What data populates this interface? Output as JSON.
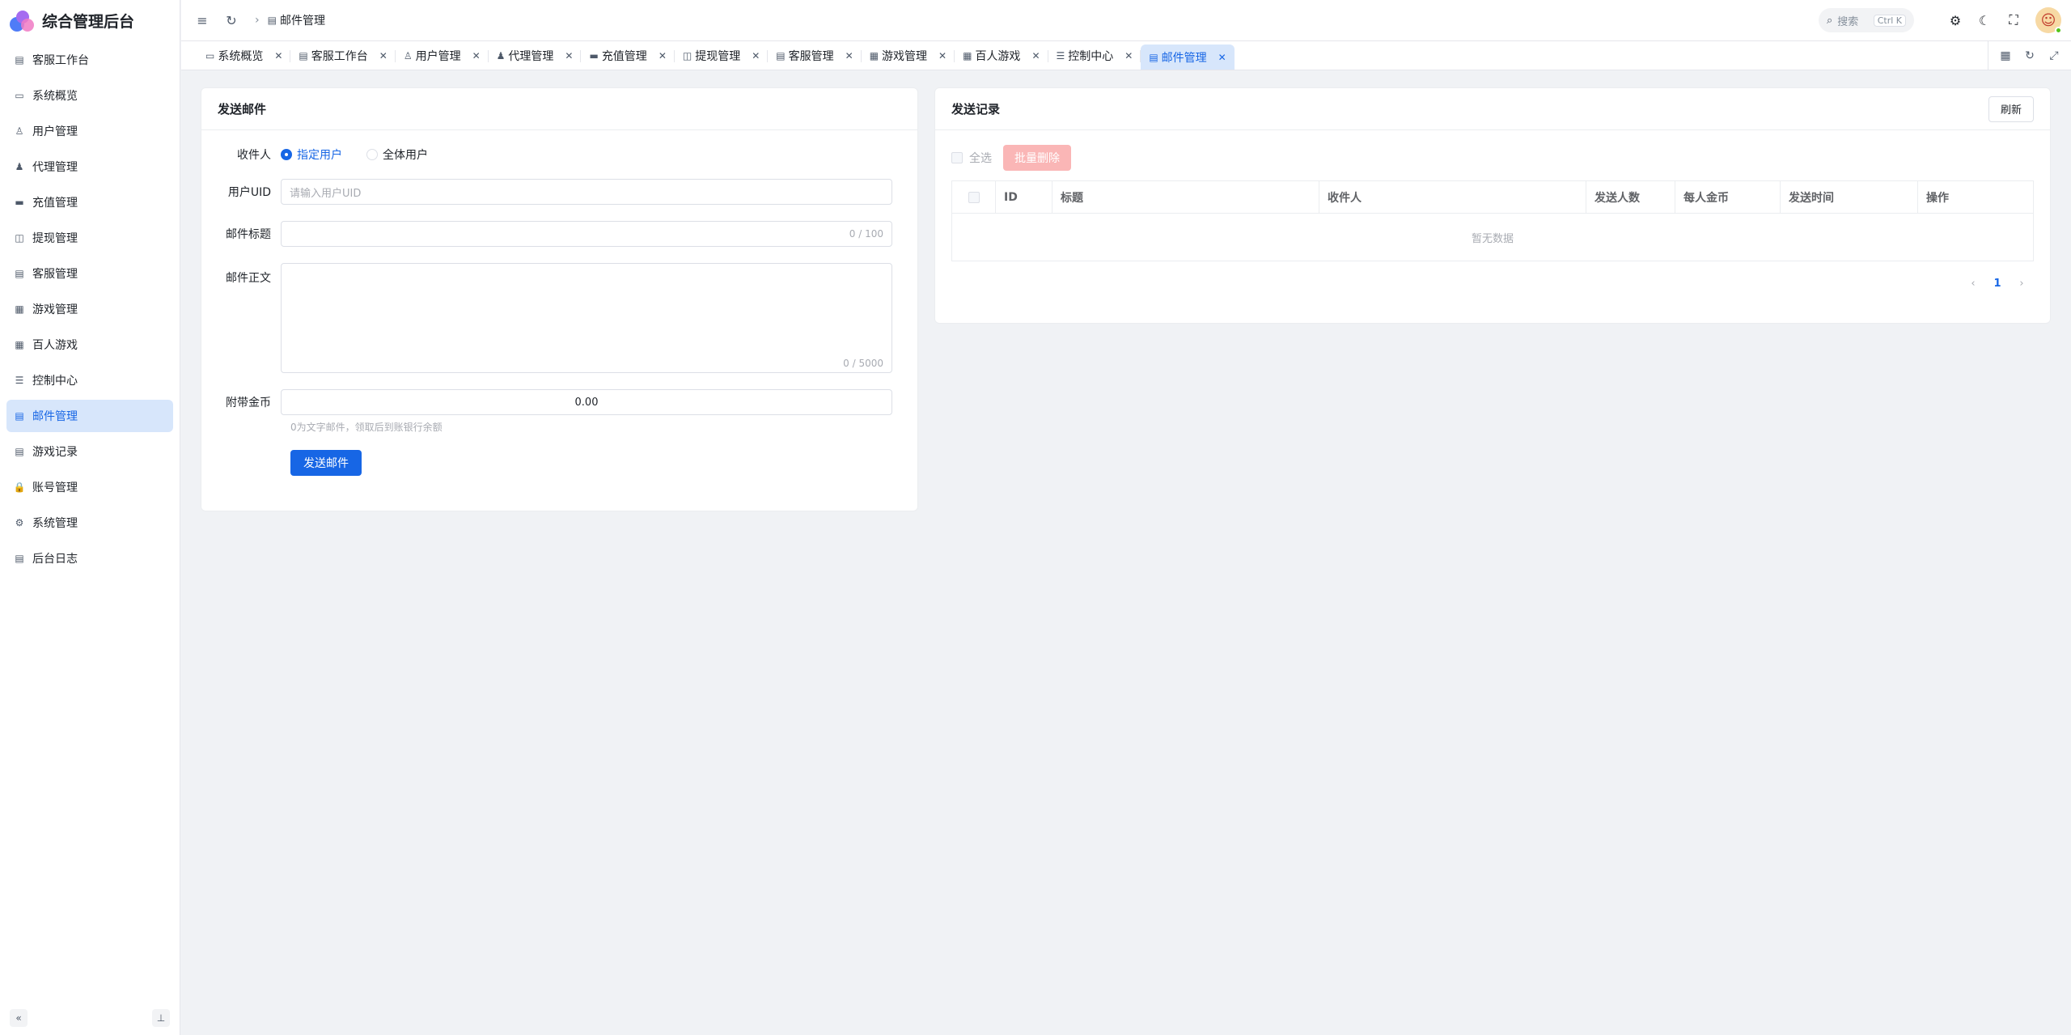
{
  "app": {
    "title": "综合管理后台"
  },
  "sidebar": {
    "items": [
      {
        "label": "客服工作台",
        "icon": "doc-icon"
      },
      {
        "label": "系统概览",
        "icon": "monitor-icon"
      },
      {
        "label": "用户管理",
        "icon": "user-icon"
      },
      {
        "label": "代理管理",
        "icon": "user-solid-icon"
      },
      {
        "label": "充值管理",
        "icon": "card-icon"
      },
      {
        "label": "提现管理",
        "icon": "wallet-icon"
      },
      {
        "label": "客服管理",
        "icon": "doc-icon"
      },
      {
        "label": "游戏管理",
        "icon": "grid-icon"
      },
      {
        "label": "百人游戏",
        "icon": "grid-icon"
      },
      {
        "label": "控制中心",
        "icon": "sliders-icon"
      },
      {
        "label": "邮件管理",
        "icon": "doc-icon",
        "active": true
      },
      {
        "label": "游戏记录",
        "icon": "doc-icon"
      },
      {
        "label": "账号管理",
        "icon": "lock-icon"
      },
      {
        "label": "系统管理",
        "icon": "gear-icon"
      },
      {
        "label": "后台日志",
        "icon": "doc-icon"
      }
    ]
  },
  "header": {
    "breadcrumb": "邮件管理",
    "search_placeholder": "搜索",
    "search_shortcut": "Ctrl K"
  },
  "tabs": [
    {
      "label": "系统概览",
      "icon": "monitor-icon"
    },
    {
      "label": "客服工作台",
      "icon": "doc-icon"
    },
    {
      "label": "用户管理",
      "icon": "user-icon"
    },
    {
      "label": "代理管理",
      "icon": "user-solid-icon"
    },
    {
      "label": "充值管理",
      "icon": "card-icon"
    },
    {
      "label": "提现管理",
      "icon": "wallet-icon"
    },
    {
      "label": "客服管理",
      "icon": "doc-icon"
    },
    {
      "label": "游戏管理",
      "icon": "grid-icon"
    },
    {
      "label": "百人游戏",
      "icon": "grid-icon"
    },
    {
      "label": "控制中心",
      "icon": "sliders-icon"
    },
    {
      "label": "邮件管理",
      "icon": "doc-icon",
      "active": true
    }
  ],
  "send_form": {
    "title": "发送邮件",
    "recipient_label": "收件人",
    "recipient_options": [
      "指定用户",
      "全体用户"
    ],
    "recipient_selected": "指定用户",
    "uid_label": "用户UID",
    "uid_placeholder": "请输入用户UID",
    "subject_label": "邮件标题",
    "subject_count": "0 / 100",
    "body_label": "邮件正文",
    "body_count": "0 / 5000",
    "gold_label": "附带金币",
    "gold_value": "0.00",
    "gold_hint": "0为文字邮件，领取后到账银行余额",
    "submit_label": "发送邮件"
  },
  "records": {
    "title": "发送记录",
    "refresh_label": "刷新",
    "select_all_label": "全选",
    "batch_delete_label": "批量删除",
    "columns": [
      "ID",
      "标题",
      "收件人",
      "发送人数",
      "每人金币",
      "发送时间",
      "操作"
    ],
    "empty_text": "暂无数据",
    "current_page": "1"
  },
  "colors": {
    "accent": "#1766e5",
    "active_bg": "#d7e6fb",
    "danger_disabled": "#fab6b6"
  }
}
